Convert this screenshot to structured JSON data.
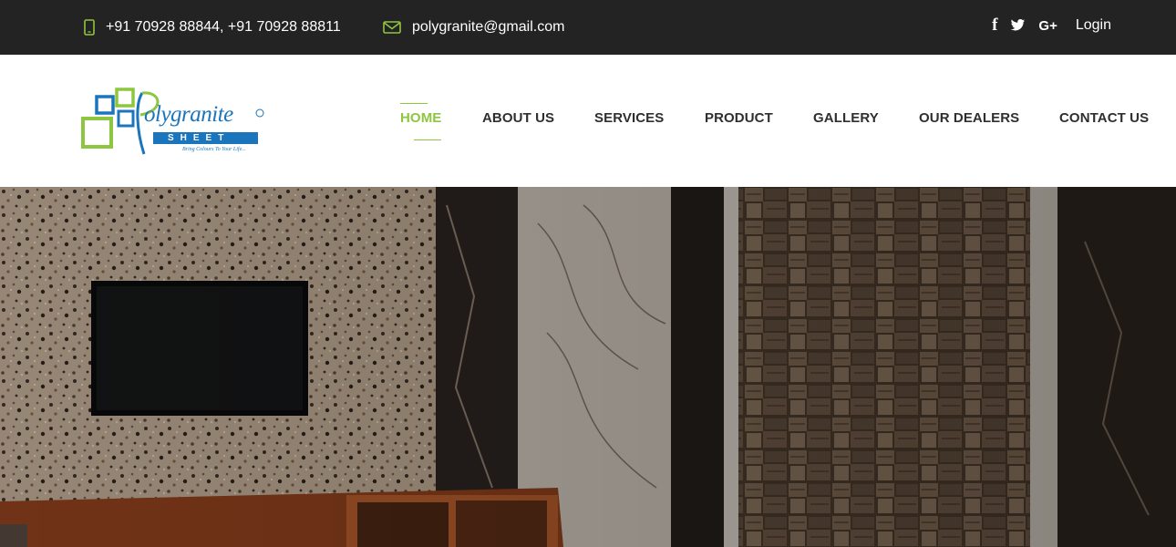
{
  "topbar": {
    "phone": "+91 70928 88844, +91 70928 88811",
    "email": "polygranite@gmail.com",
    "social": {
      "facebook": "f",
      "twitter": "twitter-icon",
      "googleplus": "G+"
    },
    "login": "Login",
    "icons": {
      "phone": "mobile-phone-icon",
      "email": "envelope-icon"
    }
  },
  "logo": {
    "word": "olygranite",
    "sub": "SHEET",
    "tagline": "Bring Colours To Your Life..."
  },
  "nav": {
    "items": [
      {
        "label": "HOME",
        "active": true
      },
      {
        "label": "ABOUT US",
        "active": false
      },
      {
        "label": "SERVICES",
        "active": false
      },
      {
        "label": "PRODUCT",
        "active": false
      },
      {
        "label": "GALLERY",
        "active": false
      },
      {
        "label": "OUR DEALERS",
        "active": false
      },
      {
        "label": "CONTACT US",
        "active": false
      }
    ]
  },
  "colors": {
    "accent": "#8dc63f",
    "topbar": "#232323",
    "logo_blue": "#1b75bc"
  }
}
